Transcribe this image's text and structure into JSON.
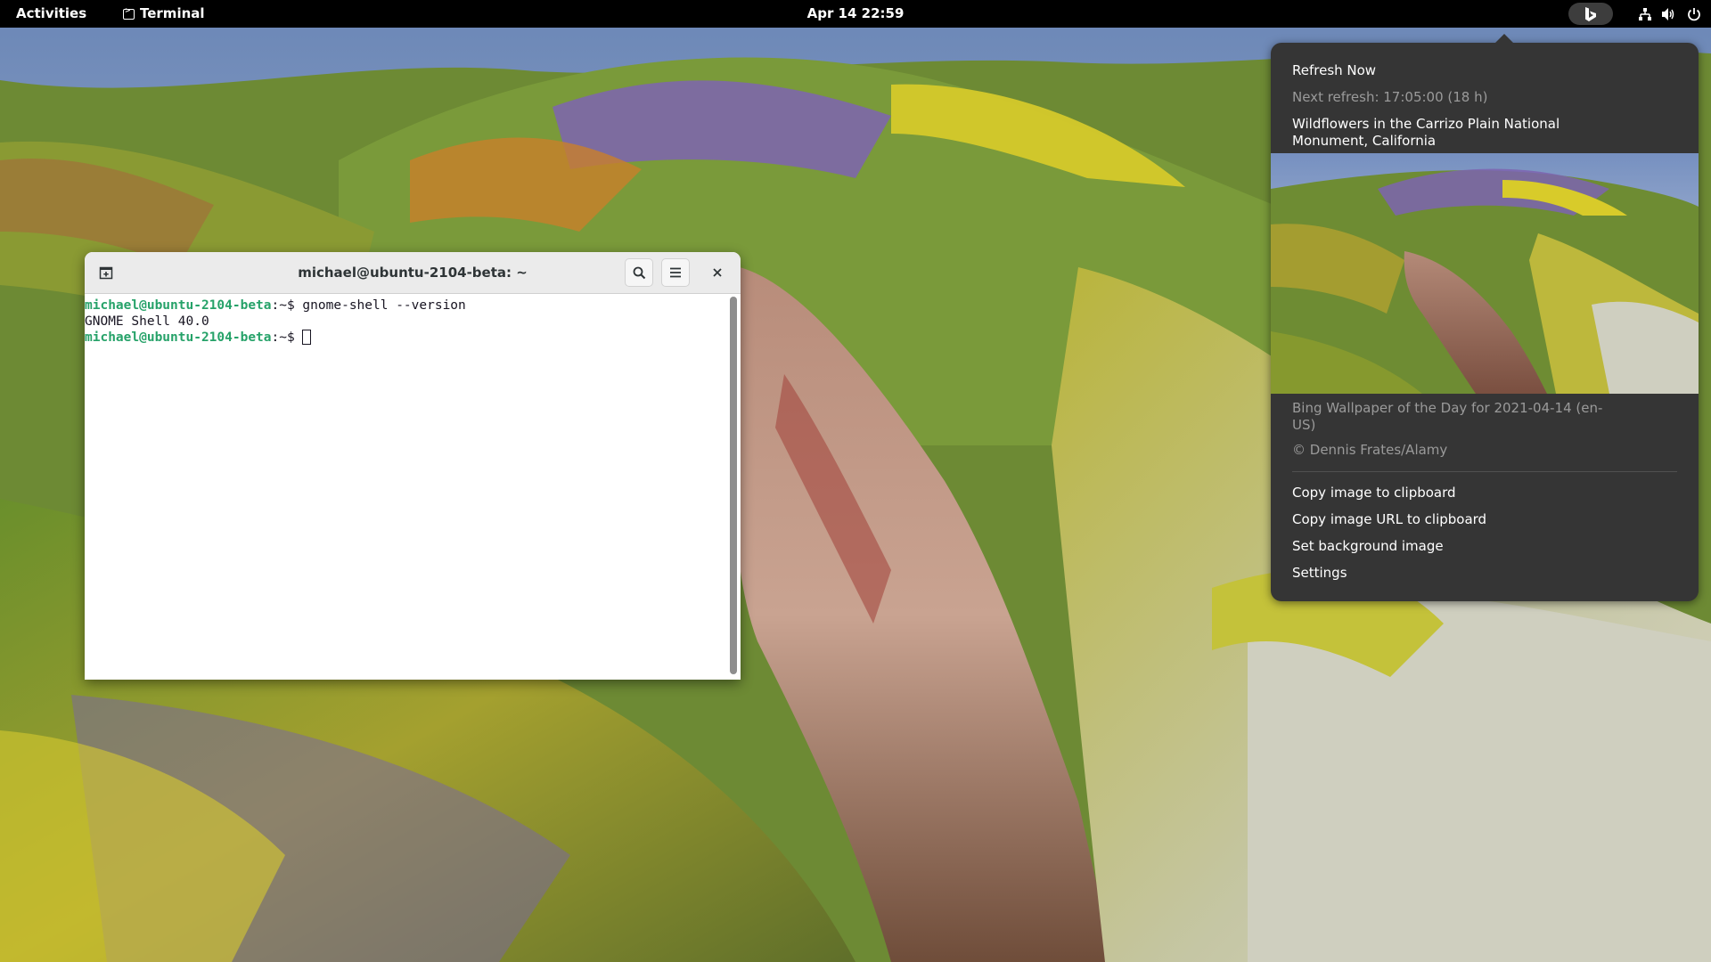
{
  "topbar": {
    "activities": "Activities",
    "app_name": "Terminal",
    "clock": "Apr 14  22:59",
    "indicator_icon": "bing-icon",
    "network_icon": "network-wired-icon",
    "volume_icon": "volume-icon",
    "power_icon": "power-icon"
  },
  "terminal": {
    "title": "michael@ubuntu-2104-beta: ~",
    "lines": [
      {
        "user": "michael@ubuntu-2104-beta",
        "rest": ":~$ gnome-shell --version"
      },
      {
        "output": "GNOME Shell 40.0"
      },
      {
        "user": "michael@ubuntu-2104-beta",
        "rest": ":~$ "
      }
    ],
    "prompt_color": "#26a269"
  },
  "bing_menu": {
    "refresh_now": "Refresh Now",
    "next_refresh": "Next refresh: 17:05:00 (18 h)",
    "title_line1": "Wildflowers in the Carrizo Plain National",
    "title_line2": "Monument, California",
    "caption_line1": "Bing Wallpaper of the Day for 2021-04-14 (en-",
    "caption_line2": "US)",
    "copyright": "© Dennis Frates/Alamy",
    "copy_image": "Copy image to clipboard",
    "copy_url": "Copy image URL to clipboard",
    "set_background": "Set background image",
    "settings": "Settings"
  },
  "colors": {
    "menu_bg": "#353535",
    "topbar_bg": "#000000",
    "terminal_header": "#ebebeb"
  }
}
